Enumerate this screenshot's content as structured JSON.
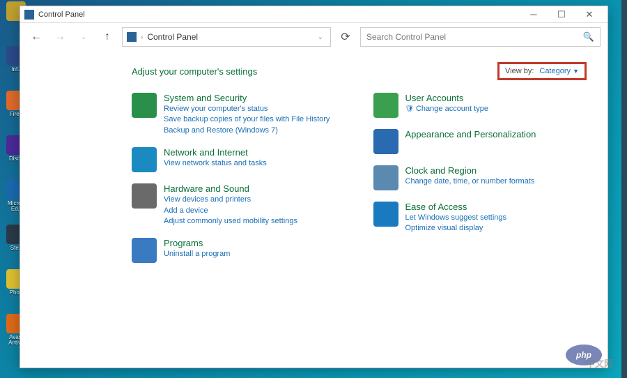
{
  "window": {
    "title": "Control Panel",
    "breadcrumb": "Control Panel",
    "search_placeholder": "Search Control Panel"
  },
  "content": {
    "heading": "Adjust your computer's settings",
    "viewby_label": "View by:",
    "viewby_value": "Category"
  },
  "categories": {
    "left": [
      {
        "icon_color": "#2a8f4a",
        "title": "System and Security",
        "links": [
          "Review your computer's status",
          "Save backup copies of your files with File History",
          "Backup and Restore (Windows 7)"
        ]
      },
      {
        "icon_color": "#1a8ac0",
        "title": "Network and Internet",
        "links": [
          "View network status and tasks"
        ]
      },
      {
        "icon_color": "#6a6a6a",
        "title": "Hardware and Sound",
        "links": [
          "View devices and printers",
          "Add a device",
          "Adjust commonly used mobility settings"
        ]
      },
      {
        "icon_color": "#3a7ac0",
        "title": "Programs",
        "links": [
          "Uninstall a program"
        ]
      }
    ],
    "right": [
      {
        "icon_color": "#3aa050",
        "title": "User Accounts",
        "shielded_links": [
          "Change account type"
        ]
      },
      {
        "icon_color": "#2a6ab0",
        "title": "Appearance and Personalization",
        "links": []
      },
      {
        "icon_color": "#5a8ab0",
        "title": "Clock and Region",
        "links": [
          "Change date, time, or number formats"
        ]
      },
      {
        "icon_color": "#1a7ac0",
        "title": "Ease of Access",
        "links": [
          "Let Windows suggest settings",
          "Optimize visual display"
        ]
      }
    ]
  },
  "desktop_icons": [
    {
      "label": "",
      "color": "#c0a030"
    },
    {
      "label": "Inf..",
      "color": "#2a4a8a"
    },
    {
      "label": "Fire..",
      "color": "#e06a2a"
    },
    {
      "label": "Disc..",
      "color": "#4a2a9a"
    },
    {
      "label": "Micro..\nEd..",
      "color": "#1a6ab0"
    },
    {
      "label": "Ste..",
      "color": "#2a3a4a"
    },
    {
      "label": "Pho..",
      "color": "#e0c030"
    },
    {
      "label": "Avast\nAntiv..",
      "color": "#e06a1a"
    }
  ],
  "watermark": "中文网",
  "php": "php"
}
